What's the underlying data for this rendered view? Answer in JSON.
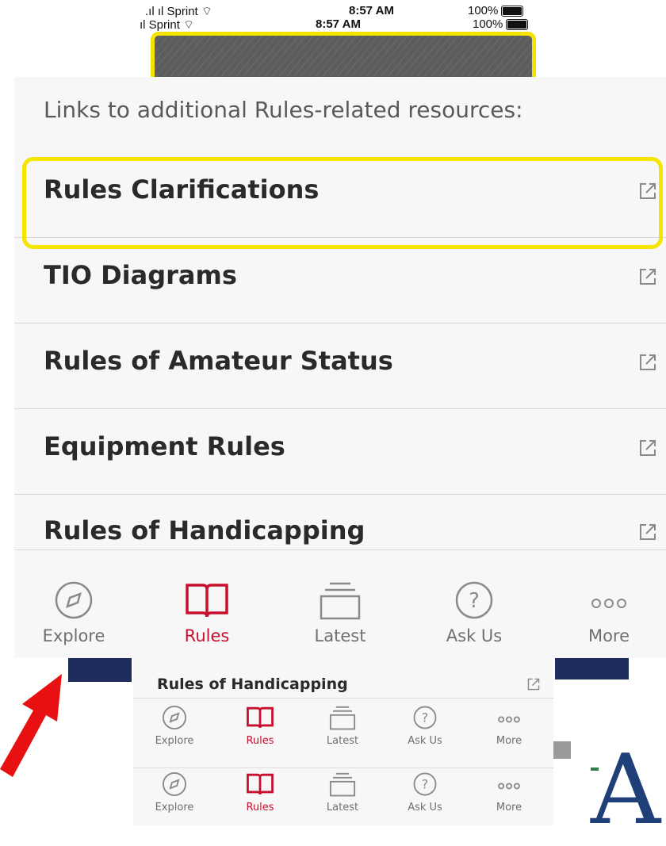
{
  "status_bar": {
    "carrier": "Sprint",
    "time": "8:57 AM",
    "battery": "100%"
  },
  "panel": {
    "intro": "Links to additional Rules-related resources:",
    "links": [
      {
        "label": "Rules Clarifications"
      },
      {
        "label": "TIO Diagrams"
      },
      {
        "label": "Rules of Amateur Status"
      },
      {
        "label": "Equipment Rules"
      },
      {
        "label": "Rules of Handicapping"
      }
    ]
  },
  "small_row": {
    "label": "Rules of Handicapping"
  },
  "tabs": [
    {
      "label": "Explore",
      "icon": "compass-icon",
      "active": false
    },
    {
      "label": "Rules",
      "icon": "book-icon",
      "active": true
    },
    {
      "label": "Latest",
      "icon": "stack-icon",
      "active": false
    },
    {
      "label": "Ask Us",
      "icon": "question-icon",
      "active": false
    },
    {
      "label": "More",
      "icon": "more-dots-icon",
      "active": false
    }
  ],
  "colors": {
    "active": "#c8102e",
    "highlight": "#f5e400",
    "arrow": "#e81010",
    "navy": "#1f2d5c"
  }
}
